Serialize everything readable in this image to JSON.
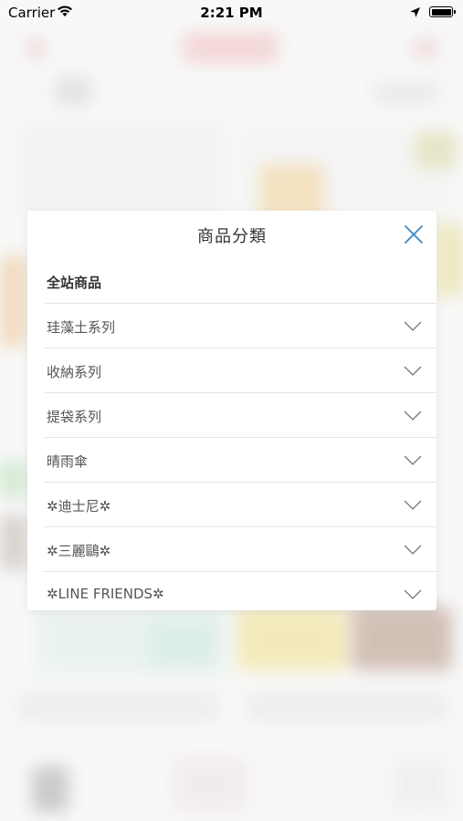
{
  "status_bar": {
    "carrier": "Carrier",
    "time": "2:21 PM"
  },
  "modal": {
    "title": "商品分類",
    "all_products": "全站商品",
    "categories": [
      {
        "label": "珪藻土系列"
      },
      {
        "label": "收納系列"
      },
      {
        "label": "提袋系列"
      },
      {
        "label": "晴雨傘"
      },
      {
        "label": "✲迪士尼✲"
      },
      {
        "label": "✲三麗鷗✲"
      },
      {
        "label": "✲LINE FRIENDS✲"
      }
    ]
  },
  "colors": {
    "accent": "#3a87c8",
    "divider": "#e5e5e5",
    "title_text": "#333333",
    "item_text": "#555555"
  },
  "icons": [
    "wifi-icon",
    "location-arrow-icon",
    "battery-icon",
    "close-icon",
    "chevron-down-icon"
  ]
}
